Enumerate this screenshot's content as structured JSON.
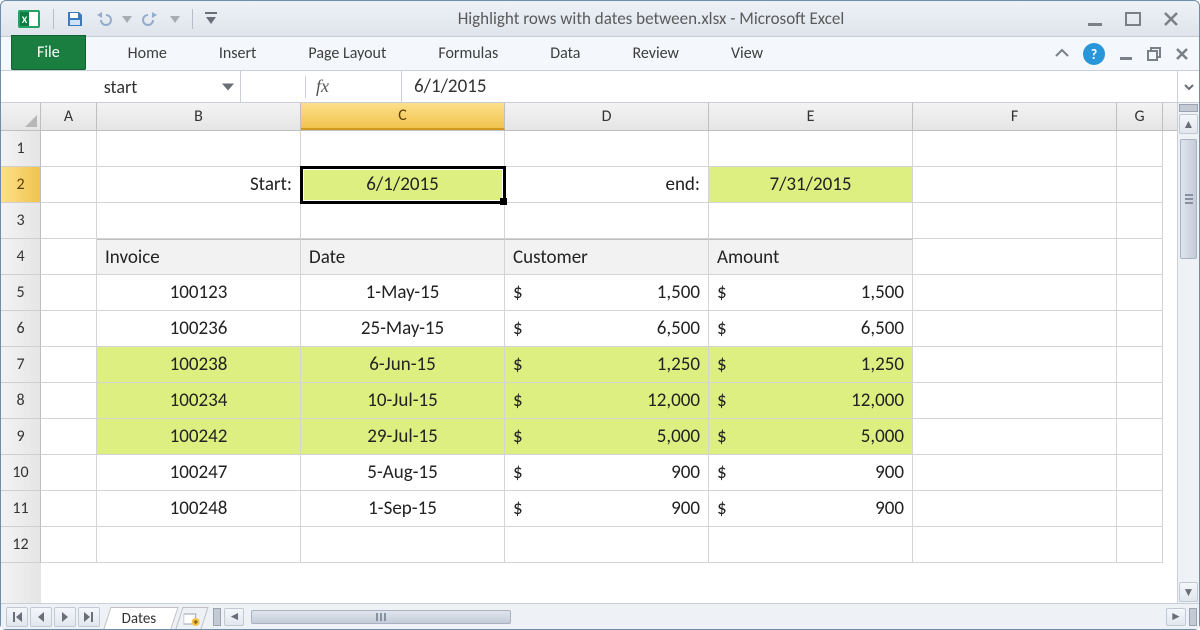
{
  "title": "Highlight rows with dates between.xlsx  -  Microsoft Excel",
  "ribbon": {
    "file": "File",
    "tabs": [
      "Home",
      "Insert",
      "Page Layout",
      "Formulas",
      "Data",
      "Review",
      "View"
    ]
  },
  "name_box": "start",
  "fx_label": "fx",
  "formula": "6/1/2015",
  "columns": [
    "A",
    "B",
    "C",
    "D",
    "E",
    "F",
    "G"
  ],
  "selected_column": "C",
  "rows": [
    "1",
    "2",
    "3",
    "4",
    "5",
    "6",
    "7",
    "8",
    "9",
    "10",
    "11",
    "12"
  ],
  "selected_row": "2",
  "selected_cell": "C2",
  "labels": {
    "start": "Start:",
    "end": "end:"
  },
  "inputs": {
    "start": "6/1/2015",
    "end": "7/31/2015"
  },
  "table": {
    "headers": {
      "invoice": "Invoice",
      "date": "Date",
      "customer": "Customer",
      "amount": "Amount"
    },
    "rows": [
      {
        "invoice": "100123",
        "date": "1-May-15",
        "customer": "1,500",
        "amount": "1,500",
        "hl": false
      },
      {
        "invoice": "100236",
        "date": "25-May-15",
        "customer": "6,500",
        "amount": "6,500",
        "hl": false
      },
      {
        "invoice": "100238",
        "date": "6-Jun-15",
        "customer": "1,250",
        "amount": "1,250",
        "hl": true
      },
      {
        "invoice": "100234",
        "date": "10-Jul-15",
        "customer": "12,000",
        "amount": "12,000",
        "hl": true
      },
      {
        "invoice": "100242",
        "date": "29-Jul-15",
        "customer": "5,000",
        "amount": "5,000",
        "hl": true
      },
      {
        "invoice": "100247",
        "date": "5-Aug-15",
        "customer": "900",
        "amount": "900",
        "hl": false
      },
      {
        "invoice": "100248",
        "date": "1-Sep-15",
        "customer": "900",
        "amount": "900",
        "hl": false
      }
    ],
    "currency_symbol": "$"
  },
  "sheet_tabs": [
    "Dates"
  ]
}
